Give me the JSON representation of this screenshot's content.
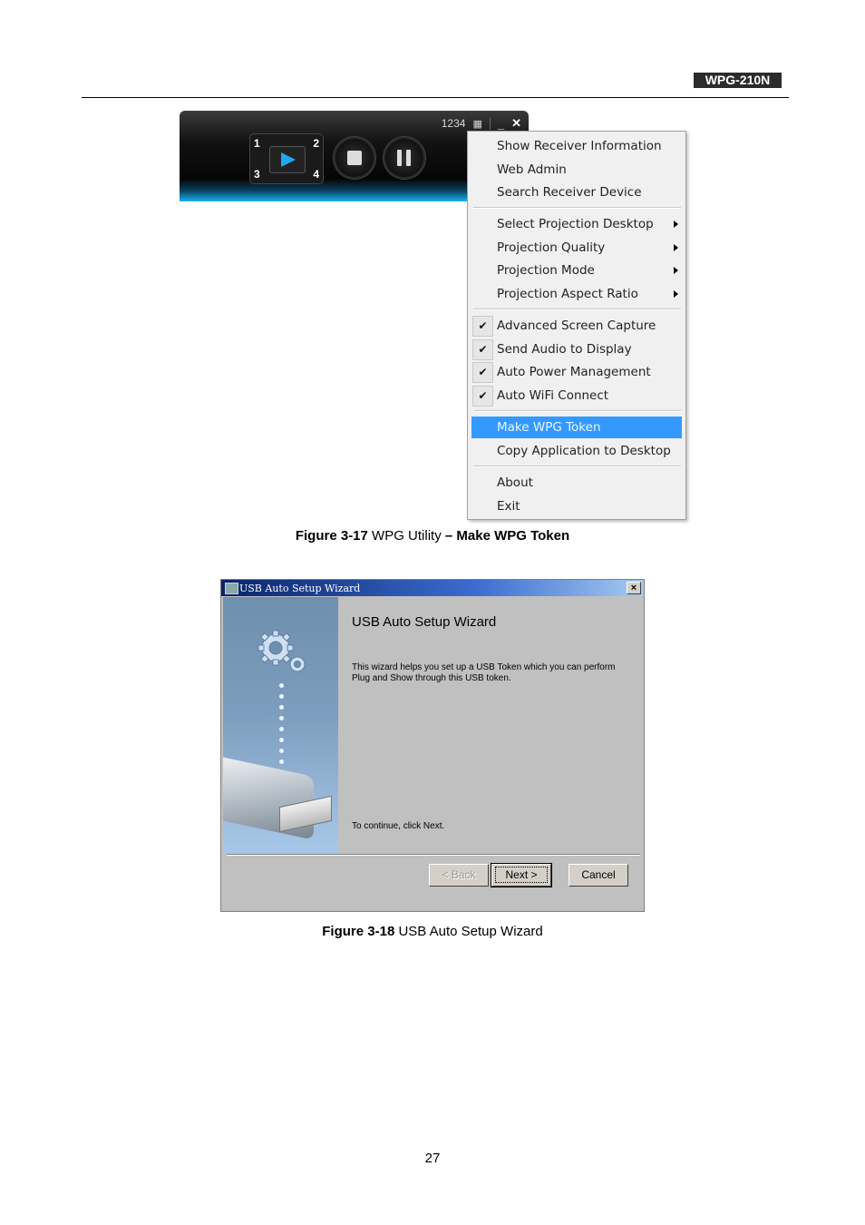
{
  "header": {
    "model": "WPG-210N"
  },
  "player": {
    "code": "1234",
    "window_icon": "layout-icon",
    "minimize": "‗",
    "close": "✕",
    "pad_numbers": [
      "1",
      "2",
      "3",
      "4"
    ]
  },
  "menu": {
    "groups": [
      [
        {
          "label": "Show Receiver Information"
        },
        {
          "label": "Web Admin"
        },
        {
          "label": "Search Receiver Device"
        }
      ],
      [
        {
          "label": "Select Projection Desktop",
          "submenu": true
        },
        {
          "label": "Projection Quality",
          "submenu": true
        },
        {
          "label": "Projection Mode",
          "submenu": true
        },
        {
          "label": "Projection Aspect Ratio",
          "submenu": true
        }
      ],
      [
        {
          "label": "Advanced Screen Capture",
          "checked": true
        },
        {
          "label": "Send Audio to Display",
          "checked": true
        },
        {
          "label": "Auto Power Management",
          "checked": true
        },
        {
          "label": "Auto WiFi Connect",
          "checked": true
        }
      ],
      [
        {
          "label": "Make WPG Token",
          "highlighted": true
        },
        {
          "label": "Copy Application to Desktop"
        }
      ],
      [
        {
          "label": "About"
        },
        {
          "label": "Exit"
        }
      ]
    ],
    "check_glyph": "✔"
  },
  "caption1": {
    "num": "Figure 3-17",
    "text": " WPG Utility ",
    "bold": "– Make WPG Token"
  },
  "wizard": {
    "title": "USB Auto Setup Wizard",
    "close": "×",
    "heading": "USB Auto Setup Wizard",
    "description": "This wizard helps you set up a USB Token which you can perform Plug and Show through this USB token.",
    "continue_text": "To continue, click Next.",
    "back": "< Back",
    "next": "Next >",
    "cancel": "Cancel"
  },
  "caption2": {
    "num": "Figure 3-18",
    "text": " USB Auto Setup Wizard"
  },
  "page_number": "27"
}
